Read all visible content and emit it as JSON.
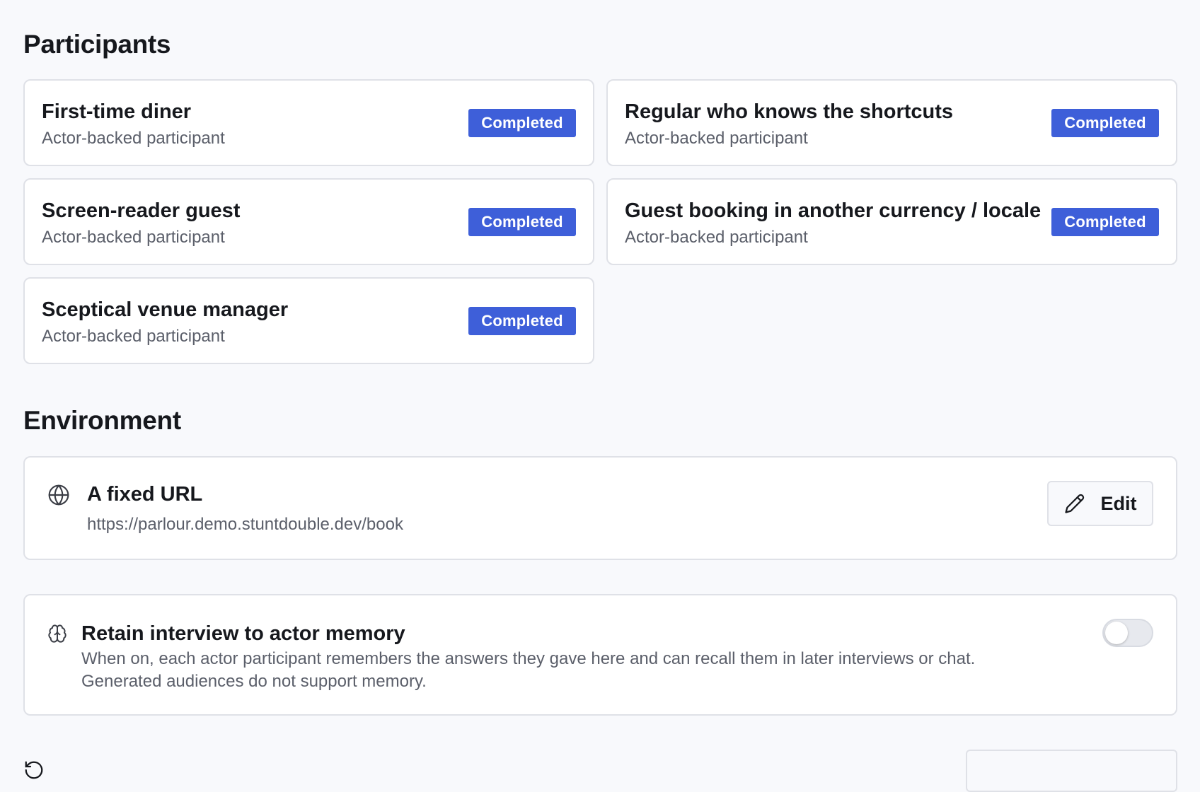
{
  "participants": {
    "title": "Participants",
    "items": [
      {
        "name": "First-time diner",
        "subtitle": "Actor-backed participant",
        "status": "Completed"
      },
      {
        "name": "Regular who knows the shortcuts",
        "subtitle": "Actor-backed participant",
        "status": "Completed"
      },
      {
        "name": "Screen-reader guest",
        "subtitle": "Actor-backed participant",
        "status": "Completed"
      },
      {
        "name": "Guest booking in another currency / locale",
        "subtitle": "Actor-backed participant",
        "status": "Completed"
      },
      {
        "name": "Sceptical venue manager",
        "subtitle": "Actor-backed participant",
        "status": "Completed"
      }
    ]
  },
  "environment": {
    "title": "Environment",
    "icon": "globe-icon",
    "type_label": "A fixed URL",
    "url": "https://parlour.demo.stuntdouble.dev/book",
    "edit_label": "Edit"
  },
  "memory": {
    "icon": "brain-icon",
    "title": "Retain interview to actor memory",
    "description": "When on, each actor participant remembers the answers they gave here and can recall them in later interviews or chat. Generated audiences do not support memory.",
    "enabled": false
  },
  "colors": {
    "badge": "#3e5fd9",
    "background": "#f8f9fc",
    "card_border": "#dfe1e7"
  }
}
